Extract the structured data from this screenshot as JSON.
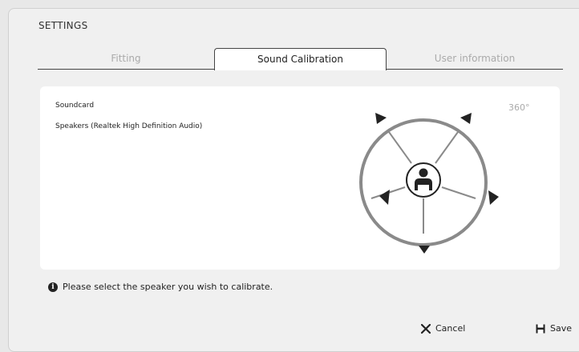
{
  "window": {
    "title": "SETTINGS"
  },
  "tabs": [
    {
      "label": "Fitting",
      "active": false
    },
    {
      "label": "Sound Calibration",
      "active": true
    },
    {
      "label": "User information",
      "active": false
    }
  ],
  "soundcard": {
    "label": "Soundcard",
    "value": "Speakers (Realtek High Definition Audio)"
  },
  "calibration": {
    "angle_label": "360°",
    "speakers": [
      "speaker-front-left",
      "speaker-front-right",
      "speaker-side-left",
      "speaker-side-right",
      "speaker-rear"
    ]
  },
  "info": {
    "icon": "info-icon",
    "text": "Please select the speaker you wish to calibrate."
  },
  "footer": {
    "cancel_label": "Cancel",
    "save_label": "Save"
  },
  "colors": {
    "ring": "#8a8a8a",
    "tab_border": "#444444",
    "inactive_tab": "#aaaaaa"
  }
}
